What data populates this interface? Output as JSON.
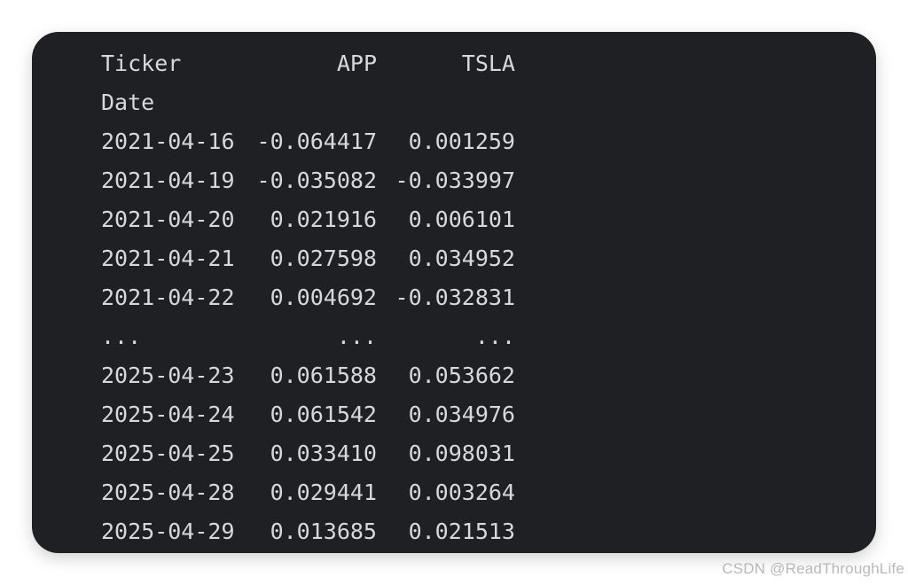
{
  "table": {
    "header": {
      "index_label": "Ticker",
      "col1": "APP",
      "col2": "TSLA"
    },
    "index_name": "Date",
    "rows": [
      {
        "date": "2021-04-16",
        "app": "-0.064417",
        "tsla": "0.001259"
      },
      {
        "date": "2021-04-19",
        "app": "-0.035082",
        "tsla": "-0.033997"
      },
      {
        "date": "2021-04-20",
        "app": "0.021916",
        "tsla": "0.006101"
      },
      {
        "date": "2021-04-21",
        "app": "0.027598",
        "tsla": "0.034952"
      },
      {
        "date": "2021-04-22",
        "app": "0.004692",
        "tsla": "-0.032831"
      },
      {
        "date": "...",
        "app": "...",
        "tsla": "..."
      },
      {
        "date": "2025-04-23",
        "app": "0.061588",
        "tsla": "0.053662"
      },
      {
        "date": "2025-04-24",
        "app": "0.061542",
        "tsla": "0.034976"
      },
      {
        "date": "2025-04-25",
        "app": "0.033410",
        "tsla": "0.098031"
      },
      {
        "date": "2025-04-28",
        "app": "0.029441",
        "tsla": "0.003264"
      },
      {
        "date": "2025-04-29",
        "app": "0.013685",
        "tsla": "0.021513"
      }
    ]
  },
  "watermark": "CSDN @ReadThroughLife",
  "colors": {
    "panel_background": "#1f2023",
    "text": "#d7d8da",
    "page_background": "#ffffff"
  }
}
